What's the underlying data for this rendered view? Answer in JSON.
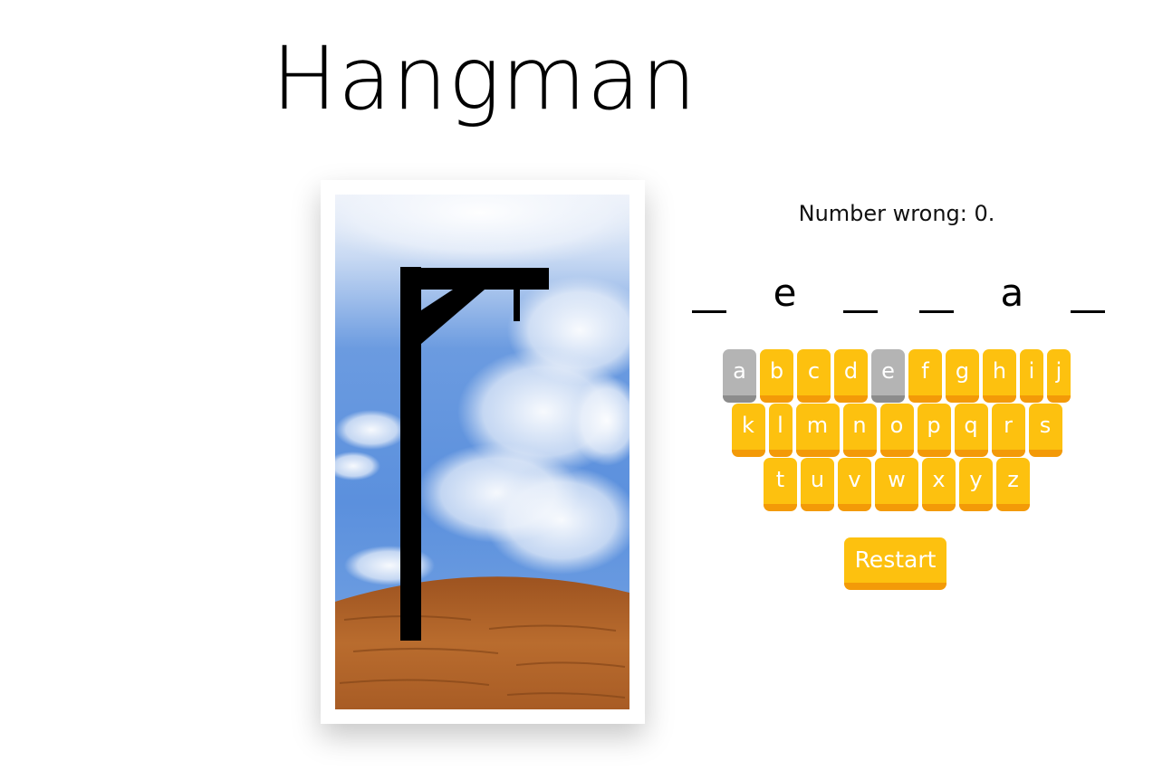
{
  "game": {
    "title": "Hangman",
    "status_text": "Number wrong: 0.",
    "restart_label": "Restart"
  },
  "word": {
    "slots": [
      "",
      "e",
      "",
      "",
      "a",
      ""
    ]
  },
  "keyboard": {
    "rows": [
      [
        {
          "label": "a",
          "used": true
        },
        {
          "label": "b",
          "used": false
        },
        {
          "label": "c",
          "used": false
        },
        {
          "label": "d",
          "used": false
        },
        {
          "label": "e",
          "used": true
        },
        {
          "label": "f",
          "used": false
        },
        {
          "label": "g",
          "used": false
        },
        {
          "label": "h",
          "used": false
        },
        {
          "label": "i",
          "used": false
        },
        {
          "label": "j",
          "used": false
        }
      ],
      [
        {
          "label": "k",
          "used": false
        },
        {
          "label": "l",
          "used": false
        },
        {
          "label": "m",
          "used": false
        },
        {
          "label": "n",
          "used": false
        },
        {
          "label": "o",
          "used": false
        },
        {
          "label": "p",
          "used": false
        },
        {
          "label": "q",
          "used": false
        },
        {
          "label": "r",
          "used": false
        },
        {
          "label": "s",
          "used": false
        }
      ],
      [
        {
          "label": "t",
          "used": false
        },
        {
          "label": "u",
          "used": false
        },
        {
          "label": "v",
          "used": false
        },
        {
          "label": "w",
          "used": false
        },
        {
          "label": "x",
          "used": false
        },
        {
          "label": "y",
          "used": false
        },
        {
          "label": "z",
          "used": false
        }
      ]
    ]
  },
  "colors": {
    "key_active": "#fdc10f",
    "key_shadow": "#f39a08",
    "key_used": "#b4b4b4",
    "sky_top": "#f4f6fb",
    "sky_blue": "#5b90dd",
    "ground": "#b5672b"
  }
}
